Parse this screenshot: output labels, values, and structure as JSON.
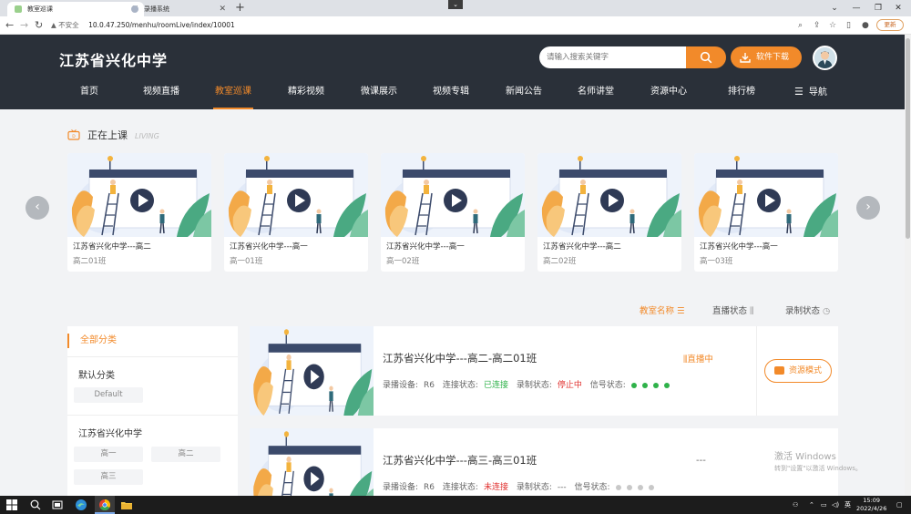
{
  "browser": {
    "tabs": [
      {
        "label": "教室巡课",
        "active": true
      },
      {
        "label": "录播系统",
        "active": false
      }
    ],
    "address": {
      "warning": "不安全",
      "url": "10.0.47.250/menhu/roomLive/index/10001"
    },
    "update_label": "更新"
  },
  "header": {
    "school_name": "江苏省兴化中学",
    "search_placeholder": "请输入搜索关键字",
    "download_label": "软件下载",
    "nav": [
      "首页",
      "视频直播",
      "教室巡课",
      "精彩视频",
      "微课展示",
      "视频专辑",
      "新闻公告",
      "名师讲堂",
      "资源中心",
      "排行榜"
    ],
    "nav_active": "教室巡课",
    "menu_label": "导航"
  },
  "living": {
    "title": "正在上课",
    "subtitle": "LIVING",
    "cards": [
      {
        "school": "江苏省兴化中学---高二",
        "class": "高二01班"
      },
      {
        "school": "江苏省兴化中学---高一",
        "class": "高一01班"
      },
      {
        "school": "江苏省兴化中学---高一",
        "class": "高一02班"
      },
      {
        "school": "江苏省兴化中学---高二",
        "class": "高二02班"
      },
      {
        "school": "江苏省兴化中学---高一",
        "class": "高一03班"
      }
    ]
  },
  "sort": {
    "room_name": "教室名称",
    "live_status": "直播状态",
    "record_status": "录制状态"
  },
  "categories": {
    "all": "全部分类",
    "groups": [
      {
        "title": "默认分类",
        "chips": [
          "Default"
        ]
      },
      {
        "title": "江苏省兴化中学",
        "chips": [
          "高一",
          "高二",
          "高三"
        ]
      }
    ]
  },
  "rooms": [
    {
      "title": "江苏省兴化中学---高二-高二01班",
      "device_label": "录播设备:",
      "device": "R6",
      "conn_label": "连接状态:",
      "conn": "已连接",
      "rec_label": "录制状态:",
      "rec": "停止中",
      "signal_label": "信号状态:",
      "live_badge": "直播中",
      "action": "资源模式",
      "dot_color": "#2fb24a"
    },
    {
      "title": "江苏省兴化中学---高三-高三01班",
      "device_label": "录播设备:",
      "device": "R6",
      "conn_label": "连接状态:",
      "conn": "未连接",
      "rec_label": "录制状态:",
      "rec": "---",
      "signal_label": "信号状态:",
      "live_badge": "---",
      "dot_color": "#c8c8c8"
    }
  ],
  "watermark": {
    "line1": "激活 Windows",
    "line2": "转到\"设置\"以激活 Windows。"
  },
  "taskbar": {
    "ime": "英",
    "time": "15:09",
    "date": "2022/4/26"
  },
  "colors": {
    "accent": "#f28a2a",
    "header_bg": "#2a3039",
    "ok": "#2fb24a",
    "error": "#e0302e"
  }
}
